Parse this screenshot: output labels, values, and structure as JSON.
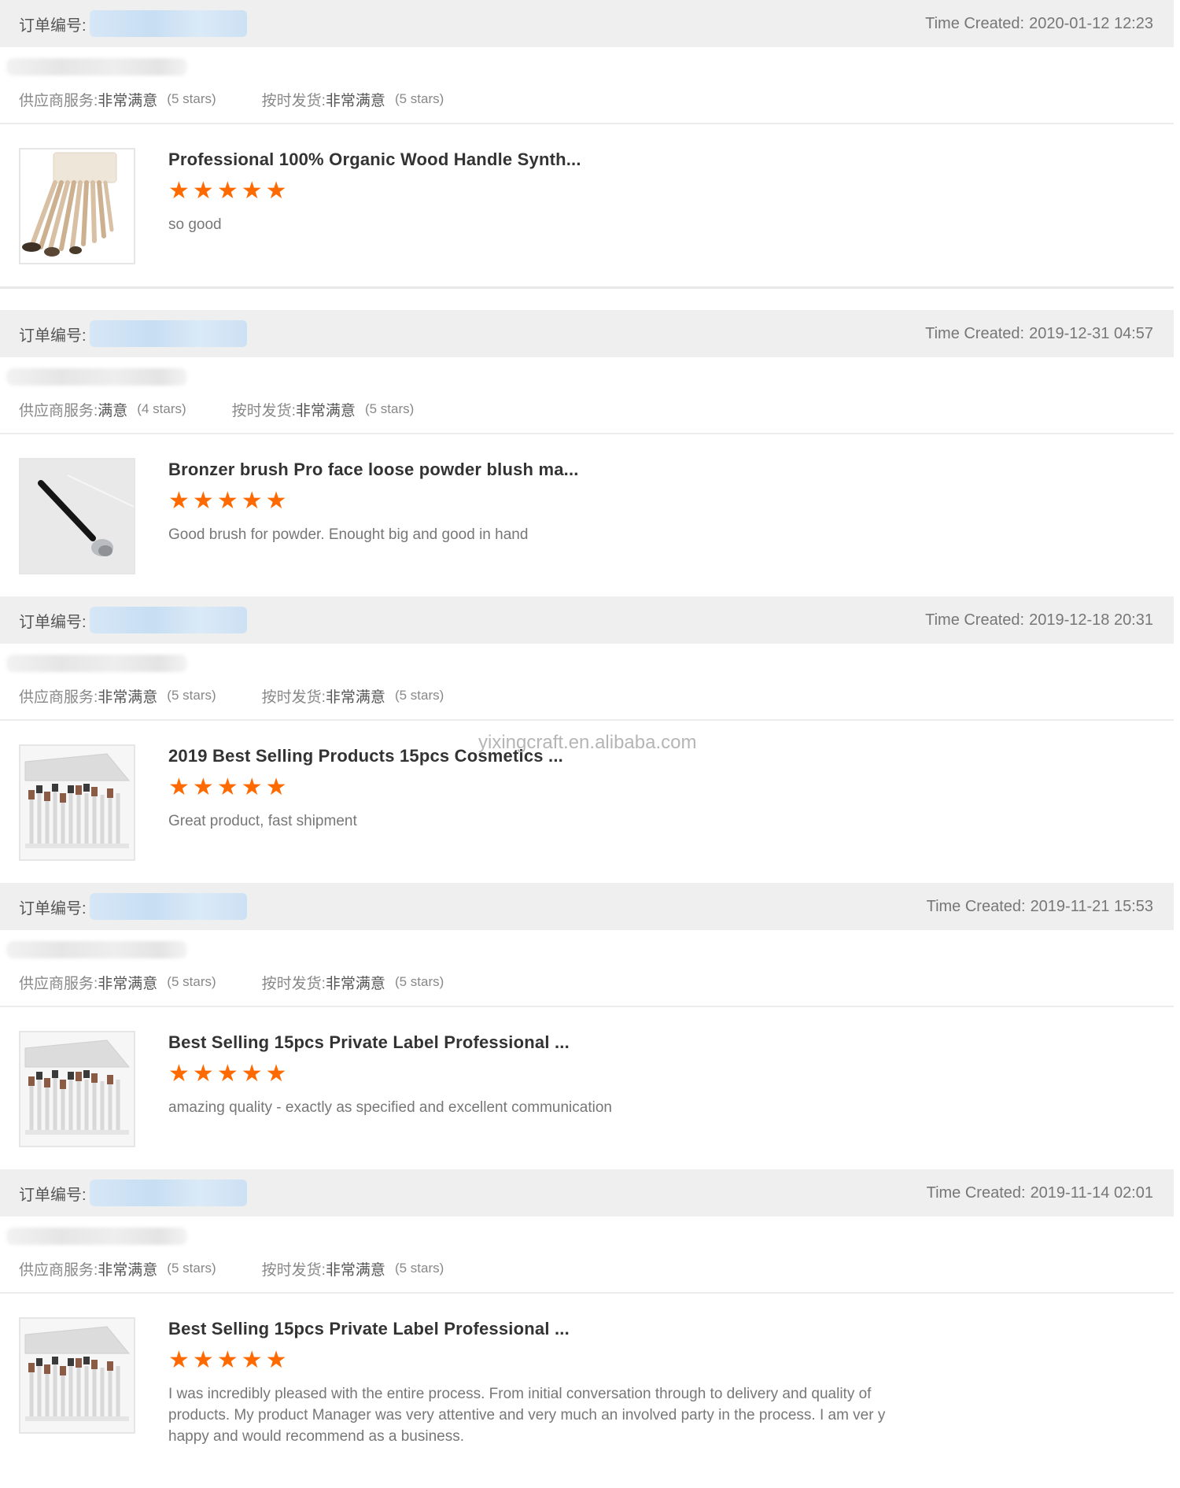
{
  "order_label": "订单编号:",
  "time_label": "Time Created:",
  "supplier_label": "供应商服务:",
  "shipping_label": "按时发货:",
  "watermark": "yixingcraft.en.alibaba.com",
  "star_color": "#ff6a00",
  "orders": [
    {
      "time": "2020-01-12 12:23",
      "supplier_value": "非常满意",
      "supplier_stars": "(5 stars)",
      "shipping_value": "非常满意",
      "shipping_stars": "(5 stars)",
      "product_title": "Professional 100% Organic Wood Handle Synth...",
      "product_image": "brush-set-with-pouch",
      "rating": 5,
      "review": "so good"
    },
    {
      "time": "2019-12-31 04:57",
      "supplier_value": "满意",
      "supplier_stars": "(4 stars)",
      "shipping_value": "非常满意",
      "shipping_stars": "(5 stars)",
      "product_title": "Bronzer brush Pro face loose powder blush ma...",
      "product_image": "single-black-brush",
      "rating": 5,
      "review": "Good brush for powder. Enought big and good in hand"
    },
    {
      "time": "2019-12-18 20:31",
      "supplier_value": "非常满意",
      "supplier_stars": "(5 stars)",
      "shipping_value": "非常满意",
      "shipping_stars": "(5 stars)",
      "product_title": "2019 Best Selling Products 15pcs Cosmetics ...",
      "product_image": "white-brush-set",
      "rating": 5,
      "review": "Great product, fast shipment"
    },
    {
      "time": "2019-11-21 15:53",
      "supplier_value": "非常满意",
      "supplier_stars": "(5 stars)",
      "shipping_value": "非常满意",
      "shipping_stars": "(5 stars)",
      "product_title": "Best Selling 15pcs Private Label Professional ...",
      "product_image": "white-brush-set",
      "rating": 5,
      "review": "amazing quality - exactly as specified and excellent communication"
    },
    {
      "time": "2019-11-14 02:01",
      "supplier_value": "非常满意",
      "supplier_stars": "(5 stars)",
      "shipping_value": "非常满意",
      "shipping_stars": "(5 stars)",
      "product_title": "Best Selling 15pcs Private Label Professional ...",
      "product_image": "white-brush-set",
      "rating": 5,
      "review": "I was incredibly pleased with the entire process. From initial conversation through to delivery and quality of products. My product Manager was very attentive and very much an involved party in the process. I am ver y happy and would recommend as a business."
    }
  ]
}
